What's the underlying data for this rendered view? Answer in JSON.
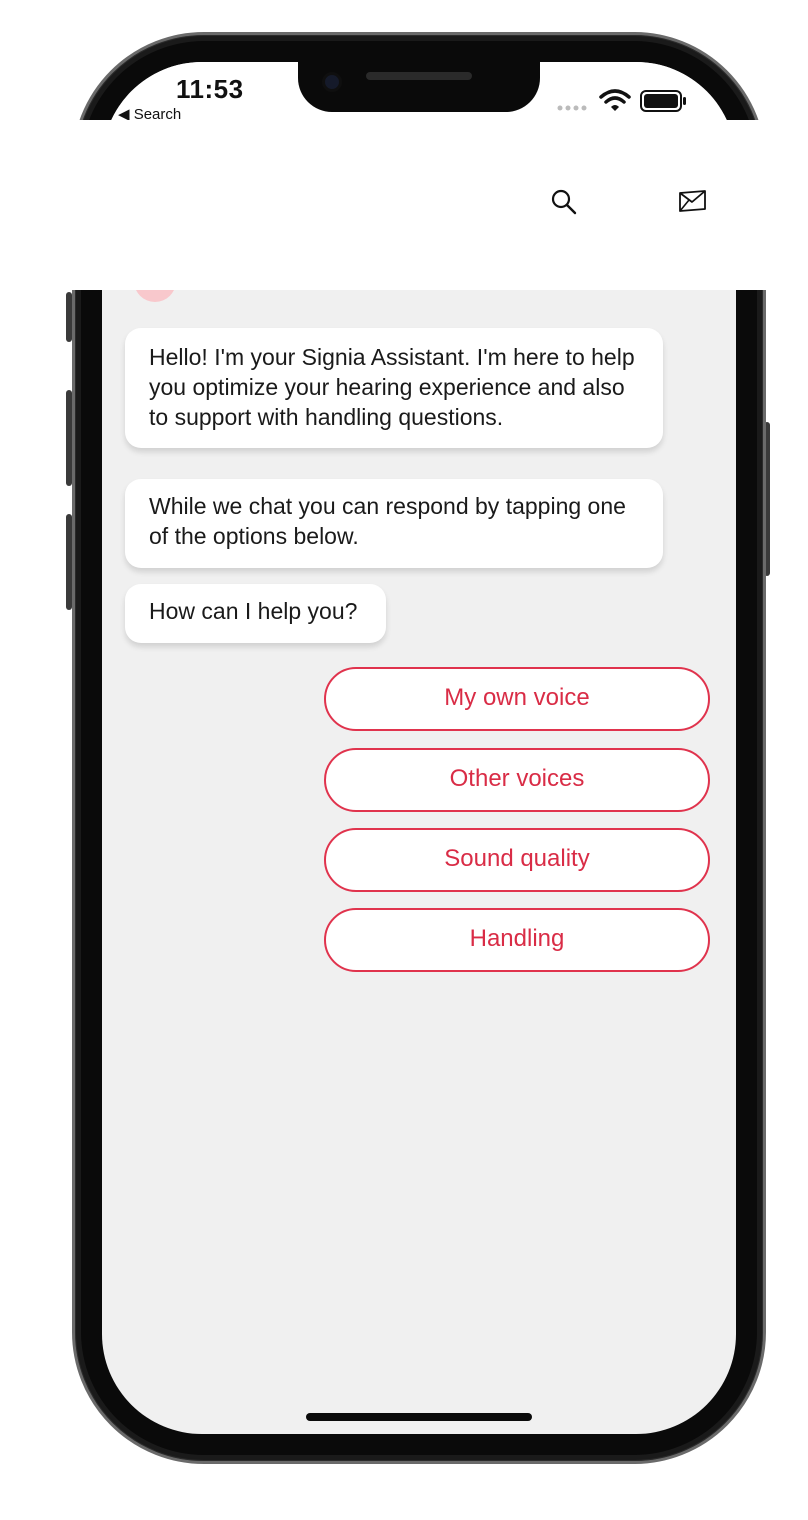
{
  "status_bar": {
    "time": "11:53",
    "back_label": "◀ Search",
    "signal_icon": "signal-dots-icon",
    "wifi_icon": "wifi-icon",
    "battery_icon": "battery-icon"
  },
  "header": {
    "search_icon": "search-icon",
    "mail_icon": "mail-icon"
  },
  "chat": {
    "messages": [
      "Hello! I'm your Signia Assistant. I'm here to help you optimize your hearing experience and also to support with handling questions.",
      "While we chat you can respond by tapping one of the options below.",
      "How can I help you?"
    ],
    "options": [
      "My own voice",
      "Other voices",
      "Sound quality",
      "Handling"
    ]
  },
  "colors": {
    "accent": "#e0334d",
    "background": "#f0f0f0",
    "bubble": "#ffffff",
    "avatar": "#f8c8cc"
  }
}
